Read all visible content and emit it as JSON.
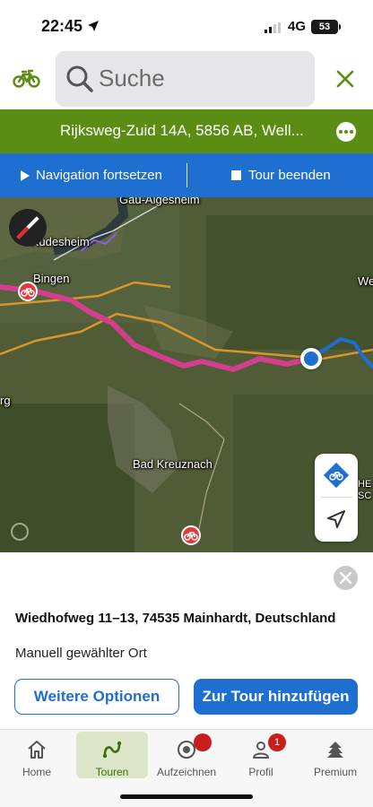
{
  "status_bar": {
    "time": "22:45",
    "network": "4G",
    "battery": "53"
  },
  "search": {
    "placeholder": "Suche",
    "value": ""
  },
  "address_bar": {
    "text": "Rijksweg-Zuid 14A, 5856 AB, Well..."
  },
  "nav_bar": {
    "continue_label": "Navigation fortsetzen",
    "end_label": "Tour beenden"
  },
  "map": {
    "labels": [
      "Gau-Algesheim",
      "Rüdesheim",
      "Bingen",
      "We",
      "rg",
      "Bad Kreuznach",
      "HE",
      "SC"
    ]
  },
  "place": {
    "title": "Wiedhofweg 11–13, 74535 Mainhardt, Deutschland",
    "subtitle": "Manuell gewählter Ort"
  },
  "actions": {
    "more_options": "Weitere Optionen",
    "add_to_tour": "Zur Tour hinzufügen"
  },
  "tabs": [
    {
      "label": "Home",
      "icon": "home-icon"
    },
    {
      "label": "Touren",
      "icon": "route-icon"
    },
    {
      "label": "Aufzeichnen",
      "icon": "record-icon"
    },
    {
      "label": "Profil",
      "icon": "profile-icon",
      "badge": "1"
    },
    {
      "label": "Premium",
      "icon": "premium-icon"
    }
  ],
  "colors": {
    "brand_green": "#5b8c14",
    "nav_blue": "#1f6fd1",
    "route_pink": "#d43f8d",
    "badge_red": "#c81e1e"
  }
}
